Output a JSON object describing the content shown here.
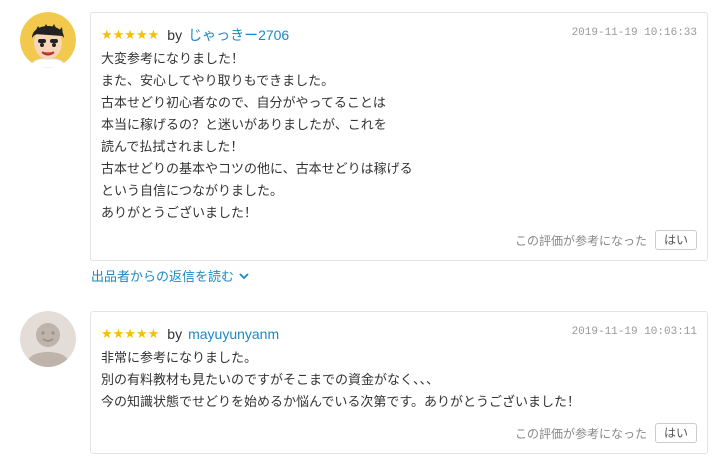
{
  "reviews": [
    {
      "stars": "★★★★★",
      "by": "by",
      "user": "じゃっきー2706",
      "date": "2019-11-19 10:16:33",
      "lines": [
        "大変参考になりました！",
        "また、安心してやり取りもできました。",
        "古本せどり初心者なので、自分がやってることは",
        "本当に稼げるの？と迷いがありましたが、これを",
        "読んで払拭されました！",
        "古本せどりの基本やコツの他に、古本せどりは稼げる",
        "という自信につながりました。",
        "ありがとうございました！"
      ],
      "helpful_label": "この評価が参考になった",
      "yes_label": "はい",
      "avatar": "cartoon-man-icon"
    },
    {
      "stars": "★★★★★",
      "by": "by",
      "user": "mayuyunyanm",
      "date": "2019-11-19 10:03:11",
      "lines": [
        "非常に参考になりました。",
        "別の有料教材も見たいのですがそこまでの資金がなく、、、",
        "今の知識状態でせどりを始めるか悩んでいる次第です。ありがとうございました！"
      ],
      "helpful_label": "この評価が参考になった",
      "yes_label": "はい",
      "avatar": "default-user-icon"
    }
  ],
  "reply_link": "出品者からの返信を読む",
  "colors": {
    "star": "#f5c000",
    "link": "#1a8ac6",
    "border": "#e3e3e3",
    "date": "#999999"
  }
}
